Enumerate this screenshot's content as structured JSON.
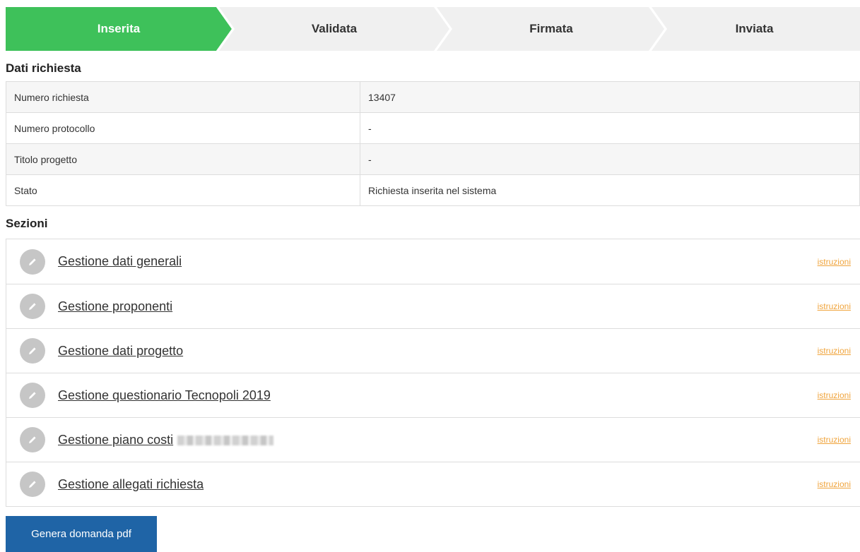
{
  "stepper": {
    "steps": [
      {
        "label": "Inserita",
        "active": true
      },
      {
        "label": "Validata",
        "active": false
      },
      {
        "label": "Firmata",
        "active": false
      },
      {
        "label": "Inviata",
        "active": false
      }
    ],
    "active_color": "#3ec15a",
    "inactive_color": "#f0f0f0"
  },
  "dati_richiesta": {
    "title": "Dati richiesta",
    "rows": [
      {
        "key": "Numero richiesta",
        "value": "13407"
      },
      {
        "key": "Numero protocollo",
        "value": "-"
      },
      {
        "key": "Titolo progetto",
        "value": "-"
      },
      {
        "key": "Stato",
        "value": "Richiesta inserita nel sistema"
      }
    ]
  },
  "sezioni": {
    "title": "Sezioni",
    "instructions_label": "istruzioni",
    "items": [
      {
        "label": "Gestione dati generali",
        "icon": "pencil-icon"
      },
      {
        "label": "Gestione proponenti",
        "icon": "pencil-icon"
      },
      {
        "label": "Gestione dati progetto",
        "icon": "pencil-icon"
      },
      {
        "label": "Gestione questionario Tecnopoli 2019",
        "icon": "pencil-icon"
      },
      {
        "label": "Gestione piano costi",
        "icon": "pencil-icon",
        "redacted_suffix": true
      },
      {
        "label": "Gestione allegati richiesta",
        "icon": "pencil-icon"
      }
    ],
    "link_color": "#f0a43c"
  },
  "actions": {
    "generate_pdf_label": "Genera domanda pdf",
    "button_color": "#1f64a6"
  }
}
